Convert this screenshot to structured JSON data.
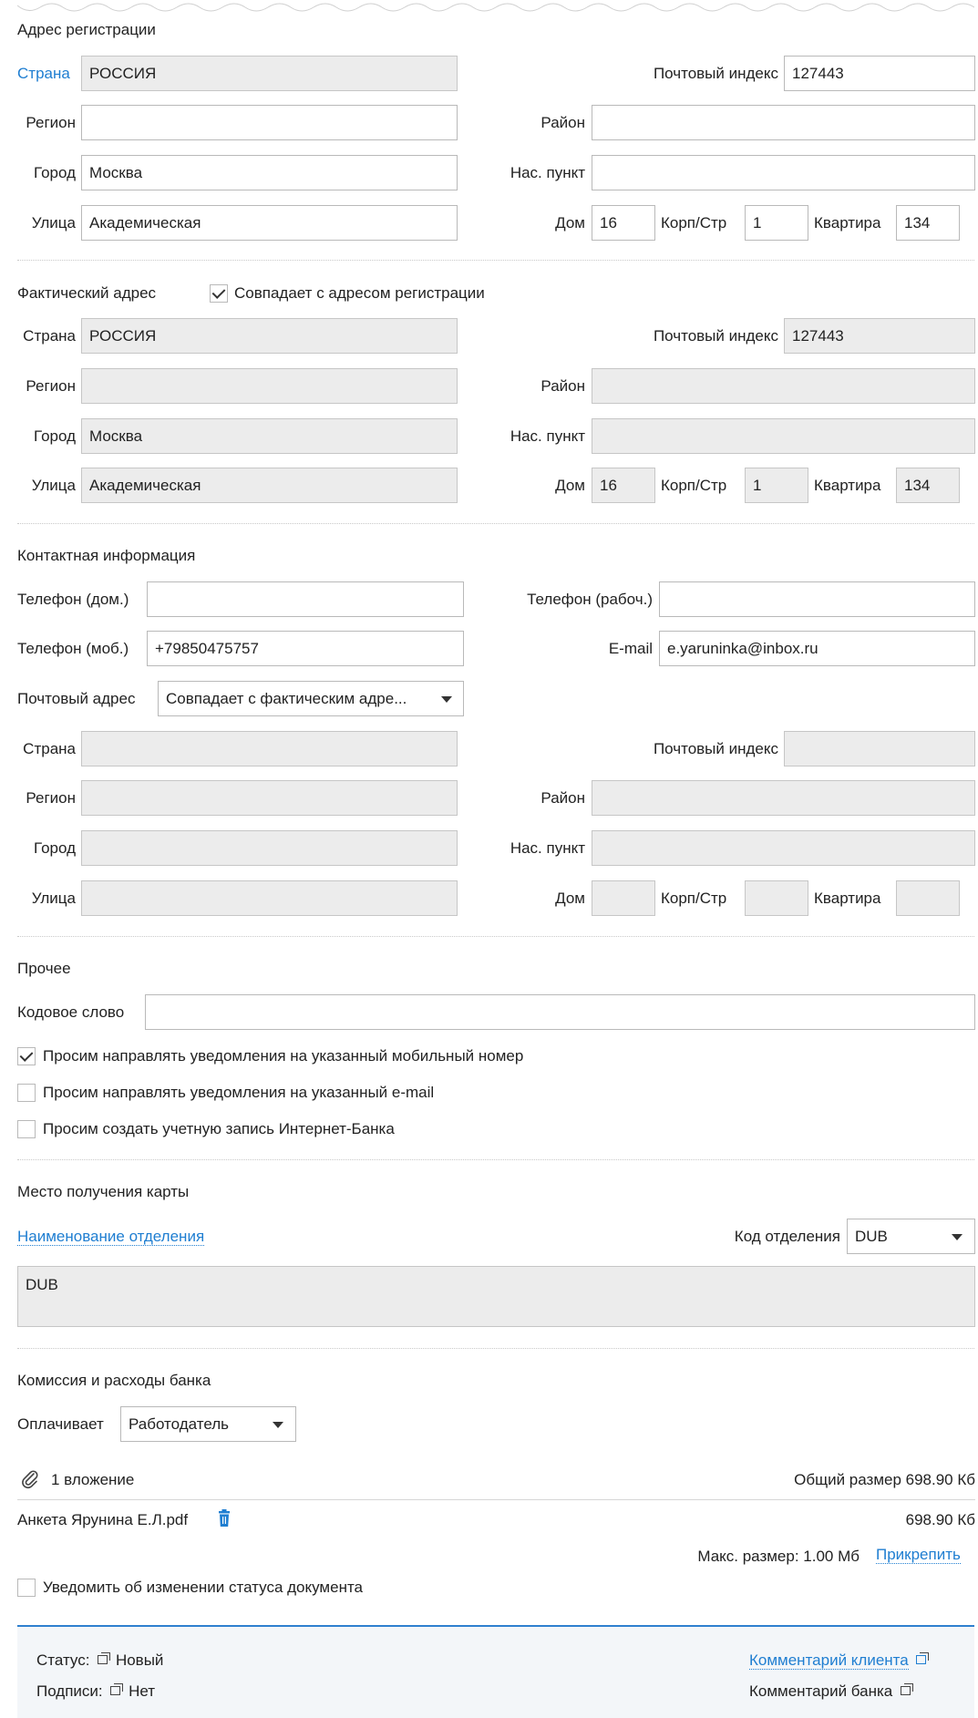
{
  "reg": {
    "title": "Адрес регистрации",
    "country_label": "Страна",
    "country": "РОССИЯ",
    "zip_label": "Почтовый индекс",
    "zip": "127443",
    "region_label": "Регион",
    "region": "",
    "district_label": "Район",
    "district": "",
    "city_label": "Город",
    "city": "Москва",
    "settlement_label": "Нас. пункт",
    "settlement": "",
    "street_label": "Улица",
    "street": "Академическая",
    "house_label": "Дом",
    "house": "16",
    "korp_label": "Корп/Стр",
    "korp": "1",
    "apt_label": "Квартира",
    "apt": "134"
  },
  "fact": {
    "title": "Фактический адрес",
    "same_label": "Совпадает с адресом регистрации",
    "same_checked": true,
    "country_label": "Страна",
    "country": "РОССИЯ",
    "zip_label": "Почтовый индекс",
    "zip": "127443",
    "region_label": "Регион",
    "region": "",
    "district_label": "Район",
    "district": "",
    "city_label": "Город",
    "city": "Москва",
    "settlement_label": "Нас. пункт",
    "settlement": "",
    "street_label": "Улица",
    "street": "Академическая",
    "house_label": "Дом",
    "house": "16",
    "korp_label": "Корп/Стр",
    "korp": "1",
    "apt_label": "Квартира",
    "apt": "134"
  },
  "contact": {
    "title": "Контактная информация",
    "phone_home_label": "Телефон (дом.)",
    "phone_home": "",
    "phone_work_label": "Телефон (рабоч.)",
    "phone_work": "",
    "phone_mob_label": "Телефон (моб.)",
    "phone_mob": "+79850475757",
    "email_label": "E-mail",
    "email": "e.yaruninka@inbox.ru",
    "postal_label": "Почтовый адрес",
    "postal_value": "Совпадает с фактическим адре...",
    "country_label": "Страна",
    "zip_label": "Почтовый индекс",
    "region_label": "Регион",
    "district_label": "Район",
    "city_label": "Город",
    "settlement_label": "Нас. пункт",
    "street_label": "Улица",
    "house_label": "Дом",
    "korp_label": "Корп/Стр",
    "apt_label": "Квартира"
  },
  "other": {
    "title": "Прочее",
    "codeword_label": "Кодовое слово",
    "codeword": "",
    "notify_mobile_label": "Просим направлять уведомления на указанный мобильный номер",
    "notify_mobile": true,
    "notify_email_label": "Просим направлять уведомления на указанный e-mail",
    "notify_email": false,
    "create_ib_label": "Просим создать учетную запись Интернет-Банка",
    "create_ib": false
  },
  "card": {
    "title": "Место получения карты",
    "branch_name_label": "Наименование отделения",
    "branch_code_label": "Код отделения",
    "branch_code": "DUB",
    "branch_text": "DUB"
  },
  "fees": {
    "title": "Комиссия и расходы банка",
    "payer_label": "Оплачивает",
    "payer": "Работодатель"
  },
  "attachments": {
    "count_text": "1 вложение",
    "total_size": "Общий размер 698.90 Кб",
    "file_name": "Анкета Ярунина Е.Л.pdf",
    "file_size": "698.90 Кб",
    "max_size": "Макс. размер: 1.00 Мб",
    "attach_link": "Прикрепить"
  },
  "notify_status_label": "Уведомить об изменении статуса документа",
  "footer": {
    "status_label": "Статус:",
    "status_value": "Новый",
    "signs_label": "Подписи:",
    "signs_value": "Нет",
    "client_comment": "Комментарий клиента",
    "bank_comment": "Комментарий банка"
  },
  "colors": {
    "link": "#1f7ed1",
    "accent_line": "#2f80cf",
    "disabled_bg": "#ececec"
  }
}
